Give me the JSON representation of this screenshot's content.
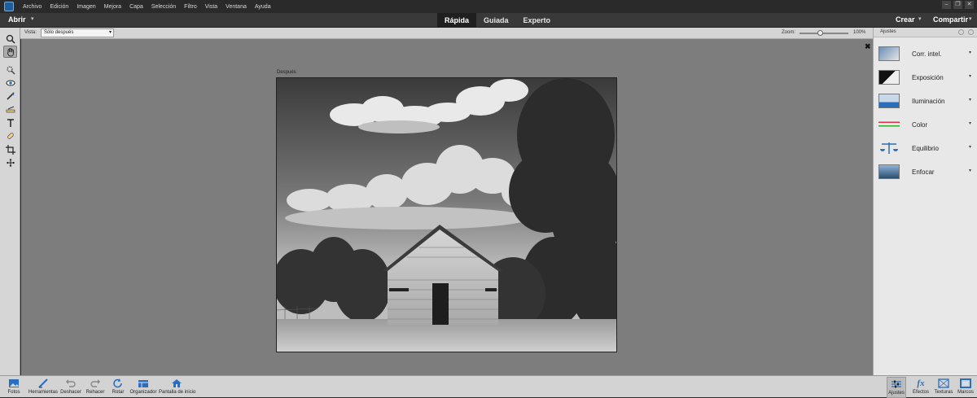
{
  "menu": {
    "items": [
      "Archivo",
      "Edición",
      "Imagen",
      "Mejora",
      "Capa",
      "Selección",
      "Filtro",
      "Vista",
      "Ventana",
      "Ayuda"
    ]
  },
  "modebar": {
    "open_label": "Abrir",
    "tabs": [
      "Rápida",
      "Guiada",
      "Experto"
    ],
    "active_tab": "Rápida",
    "create_label": "Crear",
    "share_label": "Compartir"
  },
  "options": {
    "view_label": "Vista:",
    "view_value": "Sólo después",
    "zoom_label": "Zoom:",
    "zoom_value": "100%",
    "zoom_fraction": 0.42
  },
  "canvas": {
    "after_label": "Después"
  },
  "tools": [
    "zoom-icon",
    "hand-icon",
    "quick-selection-icon",
    "red-eye-icon",
    "whiten-teeth-icon",
    "straighten-icon",
    "type-icon",
    "spot-healing-icon",
    "crop-icon",
    "move-icon"
  ],
  "panel": {
    "title": "Ajustes",
    "adjustments": [
      {
        "label": "Corr. intel.",
        "icon": "smart-fix-icon"
      },
      {
        "label": "Exposición",
        "icon": "exposure-icon"
      },
      {
        "label": "Iluminación",
        "icon": "lighting-icon"
      },
      {
        "label": "Color",
        "icon": "color-icon"
      },
      {
        "label": "Equilibrio",
        "icon": "balance-icon"
      },
      {
        "label": "Enfocar",
        "icon": "sharpen-icon"
      }
    ]
  },
  "bottom": {
    "left": [
      "Fotos",
      "Herramientas",
      "Deshacer",
      "Rehacer",
      "Rotar",
      "Organizador",
      "Pantalla de inicio"
    ],
    "right": [
      "Ajustes",
      "Efectos",
      "Texturas",
      "Marcos"
    ]
  },
  "colors": {
    "accent": "#2a6ebd",
    "canvas_bg": "#7d7d7d",
    "menubar_bg": "#2a2a2a"
  }
}
